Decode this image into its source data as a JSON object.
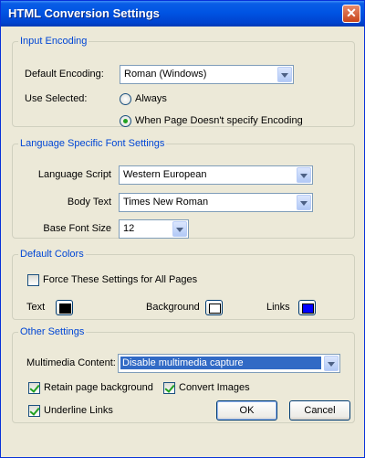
{
  "window": {
    "title": "HTML Conversion Settings",
    "close_symbol": "✕"
  },
  "input_encoding": {
    "legend": "Input Encoding",
    "default_encoding_label": "Default Encoding:",
    "default_encoding_value": "Roman (Windows)",
    "use_selected_label": "Use Selected:",
    "radio_always": "Always",
    "radio_when_unspecified": "When Page Doesn't specify Encoding",
    "selected_option": "When Page Doesn't specify Encoding"
  },
  "language_font": {
    "legend": "Language Specific Font Settings",
    "script_label": "Language Script",
    "script_value": "Western European",
    "body_text_label": "Body Text",
    "body_text_value": "Times New Roman",
    "base_font_size_label": "Base Font Size",
    "base_font_size_value": "12"
  },
  "default_colors": {
    "legend": "Default Colors",
    "force_label": "Force These Settings for All Pages",
    "force_checked": false,
    "text_label": "Text",
    "text_color": "#000000",
    "background_label": "Background",
    "background_color": "#ffffff",
    "links_label": "Links",
    "links_color": "#0000ff"
  },
  "other_settings": {
    "legend": "Other Settings",
    "multimedia_label": "Multimedia Content:",
    "multimedia_value": "Disable multimedia capture",
    "retain_bg_label": "Retain page background",
    "retain_bg_checked": true,
    "convert_images_label": "Convert Images",
    "convert_images_checked": true,
    "underline_links_label": "Underline Links",
    "underline_links_checked": true
  },
  "buttons": {
    "ok": "OK",
    "cancel": "Cancel"
  },
  "colors": {
    "title_bar": "#0054e3",
    "group_legend": "#0046d5",
    "dialog_bg": "#ece9d8",
    "selection": "#316ac5"
  }
}
